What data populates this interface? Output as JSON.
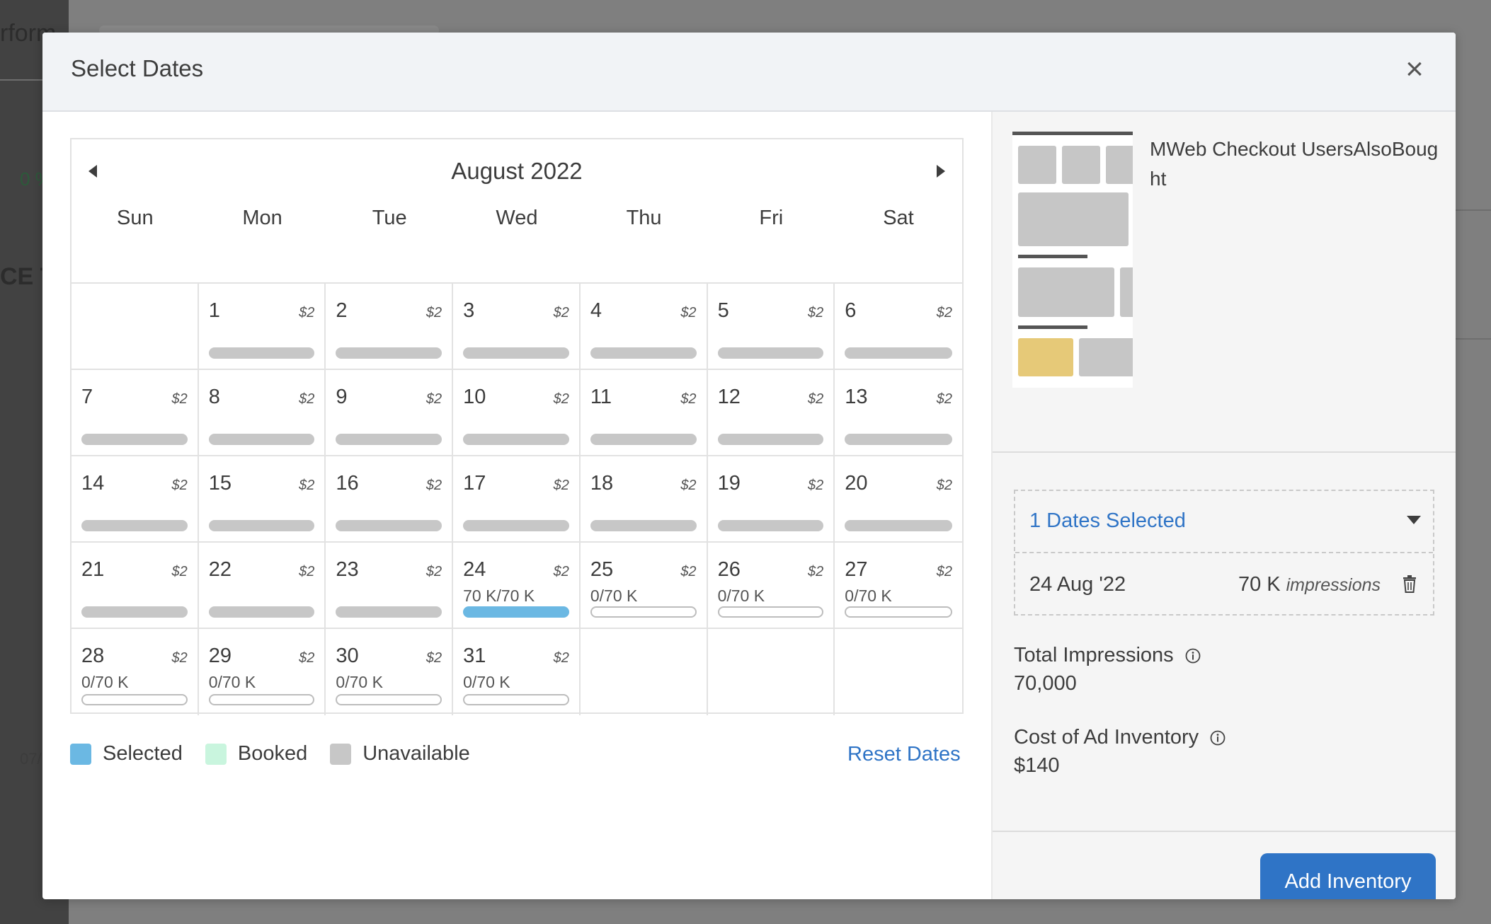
{
  "background": {
    "fragments": [
      "rform",
      "0 %",
      "CE T",
      "07/"
    ]
  },
  "modal": {
    "title": "Select Dates",
    "close_label": "×"
  },
  "calendar": {
    "month": "August 2022",
    "weekdays": [
      "Sun",
      "Mon",
      "Tue",
      "Wed",
      "Thu",
      "Fri",
      "Sat"
    ],
    "days": [
      {
        "day": "",
        "price": "",
        "avail": "",
        "status": "empty"
      },
      {
        "day": "1",
        "price": "$2",
        "avail": "",
        "status": "unavailable"
      },
      {
        "day": "2",
        "price": "$2",
        "avail": "",
        "status": "unavailable"
      },
      {
        "day": "3",
        "price": "$2",
        "avail": "",
        "status": "unavailable"
      },
      {
        "day": "4",
        "price": "$2",
        "avail": "",
        "status": "unavailable"
      },
      {
        "day": "5",
        "price": "$2",
        "avail": "",
        "status": "unavailable"
      },
      {
        "day": "6",
        "price": "$2",
        "avail": "",
        "status": "unavailable"
      },
      {
        "day": "7",
        "price": "$2",
        "avail": "",
        "status": "unavailable"
      },
      {
        "day": "8",
        "price": "$2",
        "avail": "",
        "status": "unavailable"
      },
      {
        "day": "9",
        "price": "$2",
        "avail": "",
        "status": "unavailable"
      },
      {
        "day": "10",
        "price": "$2",
        "avail": "",
        "status": "unavailable"
      },
      {
        "day": "11",
        "price": "$2",
        "avail": "",
        "status": "unavailable"
      },
      {
        "day": "12",
        "price": "$2",
        "avail": "",
        "status": "unavailable"
      },
      {
        "day": "13",
        "price": "$2",
        "avail": "",
        "status": "unavailable"
      },
      {
        "day": "14",
        "price": "$2",
        "avail": "",
        "status": "unavailable"
      },
      {
        "day": "15",
        "price": "$2",
        "avail": "",
        "status": "unavailable"
      },
      {
        "day": "16",
        "price": "$2",
        "avail": "",
        "status": "unavailable"
      },
      {
        "day": "17",
        "price": "$2",
        "avail": "",
        "status": "unavailable"
      },
      {
        "day": "18",
        "price": "$2",
        "avail": "",
        "status": "unavailable"
      },
      {
        "day": "19",
        "price": "$2",
        "avail": "",
        "status": "unavailable"
      },
      {
        "day": "20",
        "price": "$2",
        "avail": "",
        "status": "unavailable"
      },
      {
        "day": "21",
        "price": "$2",
        "avail": "",
        "status": "unavailable"
      },
      {
        "day": "22",
        "price": "$2",
        "avail": "",
        "status": "unavailable"
      },
      {
        "day": "23",
        "price": "$2",
        "avail": "",
        "status": "unavailable"
      },
      {
        "day": "24",
        "price": "$2",
        "avail": "70 K/70 K",
        "status": "selected"
      },
      {
        "day": "25",
        "price": "$2",
        "avail": "0/70 K",
        "status": "open"
      },
      {
        "day": "26",
        "price": "$2",
        "avail": "0/70 K",
        "status": "open"
      },
      {
        "day": "27",
        "price": "$2",
        "avail": "0/70 K",
        "status": "open"
      },
      {
        "day": "28",
        "price": "$2",
        "avail": "0/70 K",
        "status": "open"
      },
      {
        "day": "29",
        "price": "$2",
        "avail": "0/70 K",
        "status": "open"
      },
      {
        "day": "30",
        "price": "$2",
        "avail": "0/70 K",
        "status": "open"
      },
      {
        "day": "31",
        "price": "$2",
        "avail": "0/70 K",
        "status": "open"
      },
      {
        "day": "",
        "price": "",
        "avail": "",
        "status": "empty"
      },
      {
        "day": "",
        "price": "",
        "avail": "",
        "status": "empty"
      },
      {
        "day": "",
        "price": "",
        "avail": "",
        "status": "empty"
      }
    ],
    "prev_icon": "caret-left-icon",
    "next_icon": "caret-right-icon"
  },
  "legend": {
    "items": [
      {
        "label": "Selected",
        "color": "#6bb8e3"
      },
      {
        "label": "Booked",
        "color": "#c9f5de"
      },
      {
        "label": "Unavailable",
        "color": "#c7c7c7"
      }
    ],
    "reset_label": "Reset Dates"
  },
  "panel": {
    "widget_name": "MWeb Checkout UsersAlsoBought",
    "dates_count": "1 Dates Selected",
    "selected_dates": [
      {
        "date": "24 Aug '22",
        "impressions": "70 K",
        "unit": "impressions"
      }
    ],
    "total_label": "Total Impressions",
    "total_value": "70,000",
    "cost_label": "Cost of Ad Inventory",
    "cost_value": "$140",
    "add_button": "Add Inventory"
  },
  "colors": {
    "accent": "#2f74c6",
    "selected": "#6bb8e3",
    "booked": "#c9f5de",
    "unavailable": "#c7c7c7"
  }
}
